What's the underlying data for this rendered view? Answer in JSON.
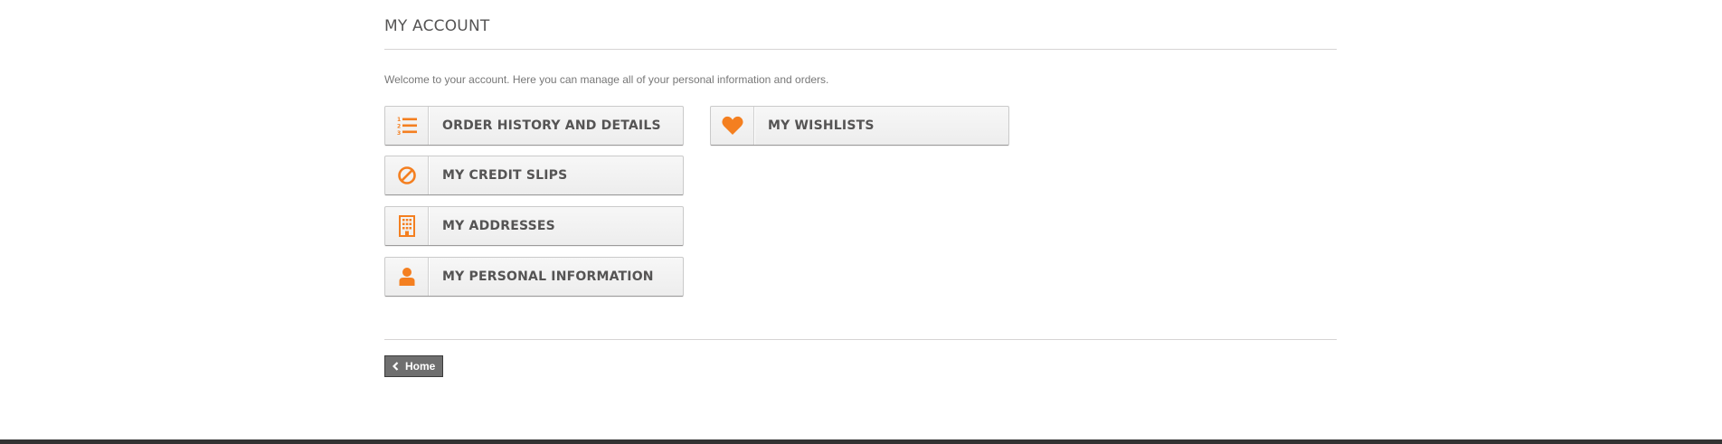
{
  "page": {
    "title": "MY ACCOUNT",
    "intro": "Welcome to your account. Here you can manage all of your personal information and orders."
  },
  "account_links": [
    {
      "label": "ORDER HISTORY AND DETAILS",
      "icon": "list-ol-icon"
    },
    {
      "label": "MY CREDIT SLIPS",
      "icon": "ban-icon"
    },
    {
      "label": "MY ADDRESSES",
      "icon": "building-icon"
    },
    {
      "label": "MY PERSONAL INFORMATION",
      "icon": "user-icon"
    }
  ],
  "wishlist_link": {
    "label": "MY WISHLISTS",
    "icon": "heart-icon"
  },
  "footer": {
    "home_label": "Home",
    "home_icon": "chevron-left-icon"
  },
  "colors": {
    "accent": "#f47f20",
    "text": "#555454",
    "home_bg": "#6f6f6f"
  }
}
